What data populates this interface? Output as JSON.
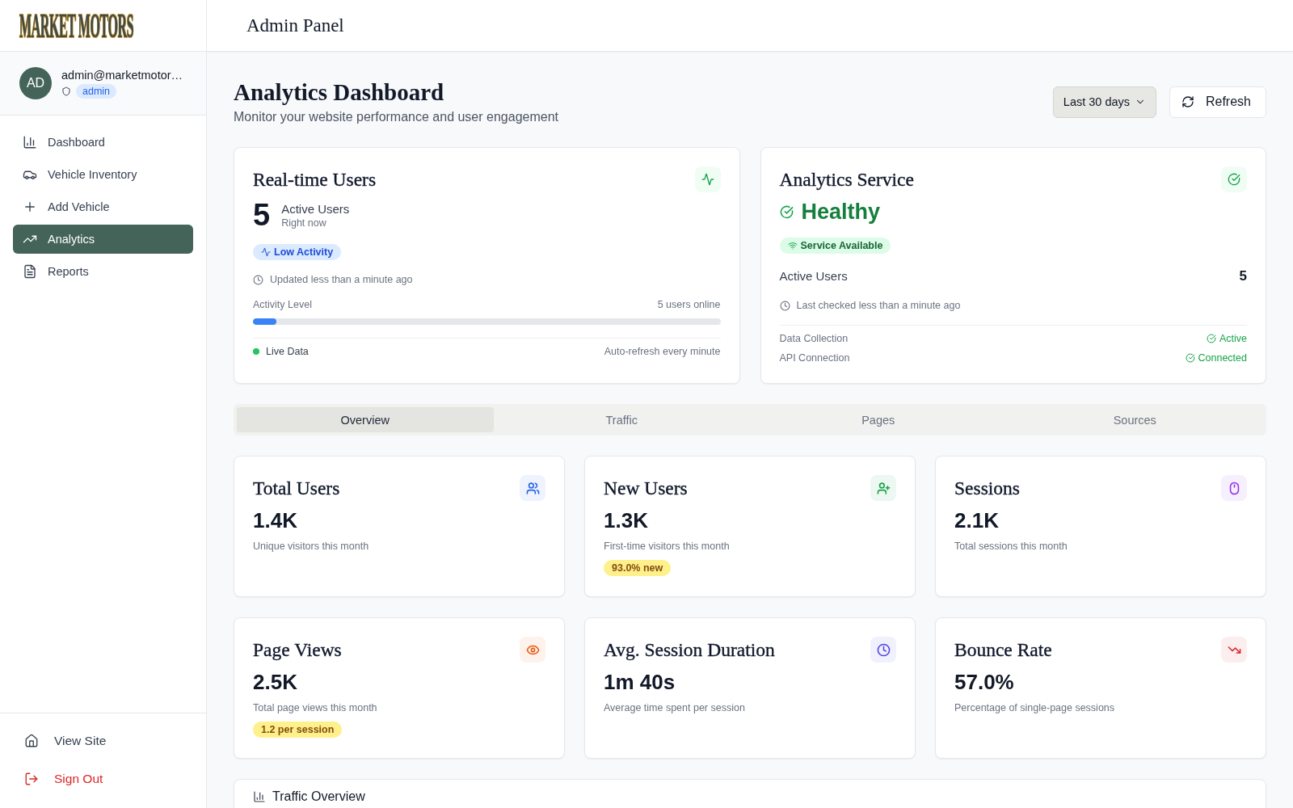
{
  "sidebar": {
    "logo": "MARKET MOTORS",
    "user": {
      "initials": "AD",
      "email": "admin@marketmotor…",
      "role": "admin"
    },
    "nav_items": [
      {
        "label": "Dashboard",
        "selected": false
      },
      {
        "label": "Vehicle Inventory",
        "selected": false
      },
      {
        "label": "Add Vehicle",
        "selected": false
      },
      {
        "label": "Analytics",
        "selected": true
      },
      {
        "label": "Reports",
        "selected": false
      }
    ],
    "footer_items": [
      {
        "label": "View Site",
        "kind": "link"
      },
      {
        "label": "Sign Out",
        "kind": "danger"
      }
    ]
  },
  "header": {
    "title": "Admin Panel"
  },
  "page": {
    "title": "Analytics Dashboard",
    "subtitle": "Monitor your website performance and user engagement",
    "range_select": {
      "value": "Last 30 days"
    },
    "refresh_button": "Refresh"
  },
  "realtime_card": {
    "title": "Real-time Users",
    "count": "5",
    "count_label": "Active Users",
    "count_sublabel": "Right now",
    "activity_badge": "Low Activity",
    "updated": "Updated less than a minute ago",
    "activity_label": "Activity Level",
    "online": "5 users online",
    "level": 0.05,
    "live_label": "Live Data",
    "refresh_note": "Auto-refresh every minute"
  },
  "service_card": {
    "title": "Analytics Service",
    "status": "Healthy",
    "badge": "Service Available",
    "active_users_label": "Active Users",
    "active_users": "5",
    "last_checked": "Last checked less than a minute ago",
    "checks": [
      {
        "label": "Data Collection",
        "value": "Active"
      },
      {
        "label": "API Connection",
        "value": "Connected"
      }
    ]
  },
  "tabs": [
    {
      "label": "Overview",
      "selected": true
    },
    {
      "label": "Traffic",
      "selected": false
    },
    {
      "label": "Pages",
      "selected": false
    },
    {
      "label": "Sources",
      "selected": false
    }
  ],
  "metrics": [
    {
      "title": "Total Users",
      "value": "1.4K",
      "description": "Unique visitors this month",
      "color": "#2563eb"
    },
    {
      "title": "New Users",
      "value": "1.3K",
      "description": "First-time visitors this month",
      "badge": "93.0% new",
      "color": "#16a34a"
    },
    {
      "title": "Sessions",
      "value": "2.1K",
      "description": "Total sessions this month",
      "color": "#9333ea"
    },
    {
      "title": "Page Views",
      "value": "2.5K",
      "description": "Total page views this month",
      "badge": "1.2 per session",
      "color": "#ea580c"
    },
    {
      "title": "Avg. Session Duration",
      "value": "1m 40s",
      "description": "Average time spent per session",
      "color": "#4f46e5"
    },
    {
      "title": "Bounce Rate",
      "value": "57.0%",
      "description": "Percentage of single-page sessions",
      "color": "#dc2626"
    }
  ],
  "traffic_card": {
    "title": "Traffic Overview"
  }
}
